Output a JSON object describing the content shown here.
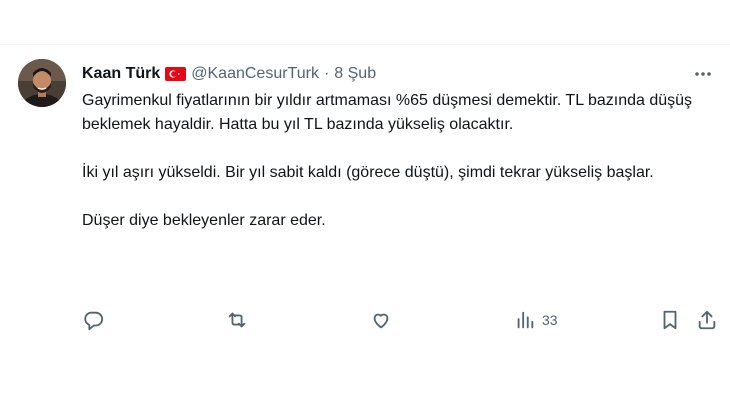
{
  "tweet": {
    "author": {
      "name": "Kaan Türk",
      "flag": "turkey-flag",
      "handle": "@KaanCesurTurk",
      "separator": "·",
      "date": "8 Şub"
    },
    "text": {
      "p1": "Gayrimenkul fiyatlarının bir yıldır artmaması %65 düşmesi demektir. TL bazında düşüş beklemek hayaldir. Hatta bu yıl TL bazında yükseliş olacaktır.",
      "p2": "İki yıl aşırı yükseldi. Bir yıl sabit kaldı (görece düştü), şimdi tekrar yükseliş başlar.",
      "p3": "Düşer diye bekleyenler zarar eder."
    },
    "actions": {
      "reply_icon": "reply-icon",
      "retweet_icon": "retweet-icon",
      "like_icon": "heart-icon",
      "views_icon": "views-icon",
      "views_count": "33",
      "bookmark_icon": "bookmark-icon",
      "share_icon": "share-icon"
    },
    "more_icon": "more-icon"
  },
  "colors": {
    "text": "#0f1419",
    "muted": "#536471",
    "divider": "#eff3f4",
    "flag_red": "#e30a17"
  }
}
